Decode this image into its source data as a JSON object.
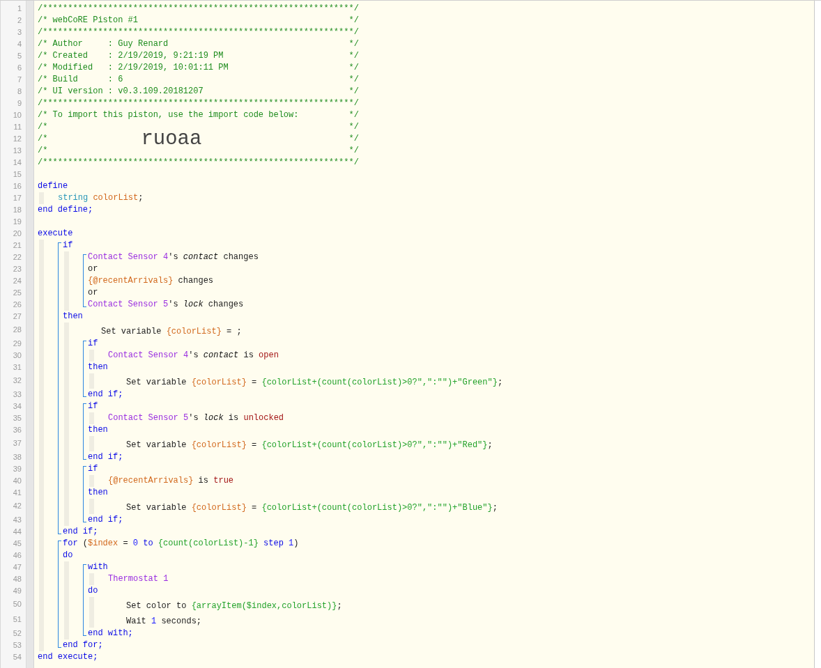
{
  "editor": {
    "lines": [
      {
        "number": "1",
        "kind": "line",
        "tokens": [
          {
            "kind": "comment",
            "text": "/**************************************************************/"
          }
        ]
      },
      {
        "number": "2",
        "kind": "line",
        "tokens": [
          {
            "kind": "comment",
            "text": "/* webCoRE Piston #1"
          },
          {
            "kind": "comment-end",
            "text": "*/"
          }
        ]
      },
      {
        "number": "3",
        "kind": "line",
        "tokens": [
          {
            "kind": "comment",
            "text": "/**************************************************************/"
          }
        ]
      },
      {
        "number": "4",
        "kind": "line",
        "tokens": [
          {
            "kind": "comment",
            "text": "/* Author     : Guy Renard"
          },
          {
            "kind": "comment-end",
            "text": "*/"
          }
        ]
      },
      {
        "number": "5",
        "kind": "line",
        "tokens": [
          {
            "kind": "comment",
            "text": "/* Created    : 2/19/2019, 9:21:19 PM"
          },
          {
            "kind": "comment-end",
            "text": "*/"
          }
        ]
      },
      {
        "number": "6",
        "kind": "line",
        "tokens": [
          {
            "kind": "comment",
            "text": "/* Modified   : 2/19/2019, 10:01:11 PM"
          },
          {
            "kind": "comment-end",
            "text": "*/"
          }
        ]
      },
      {
        "number": "7",
        "kind": "line",
        "tokens": [
          {
            "kind": "comment",
            "text": "/* Build      : 6"
          },
          {
            "kind": "comment-end",
            "text": "*/"
          }
        ]
      },
      {
        "number": "8",
        "kind": "line",
        "tokens": [
          {
            "kind": "comment",
            "text": "/* UI version : v0.3.109.20181207"
          },
          {
            "kind": "comment-end",
            "text": "*/"
          }
        ]
      },
      {
        "number": "9",
        "kind": "line",
        "tokens": [
          {
            "kind": "comment",
            "text": "/**************************************************************/"
          }
        ]
      },
      {
        "number": "10",
        "kind": "line",
        "tokens": [
          {
            "kind": "comment",
            "text": "/* To import this piston, use the import code below:"
          },
          {
            "kind": "comment-end",
            "text": "*/"
          }
        ]
      },
      {
        "number": "11",
        "kind": "line",
        "tokens": [
          {
            "kind": "comment",
            "text": "/*"
          },
          {
            "kind": "comment-end",
            "text": "*/"
          }
        ]
      },
      {
        "number": "12",
        "kind": "line",
        "tokens": [
          {
            "kind": "comment",
            "text": "/*"
          },
          {
            "kind": "import-code",
            "text": "ruoaa"
          },
          {
            "kind": "comment-end",
            "text": "*/"
          }
        ]
      },
      {
        "number": "13",
        "kind": "line",
        "tokens": [
          {
            "kind": "comment",
            "text": "/*"
          },
          {
            "kind": "comment-end",
            "text": "*/"
          }
        ]
      },
      {
        "number": "14",
        "kind": "line",
        "tokens": [
          {
            "kind": "comment",
            "text": "/**************************************************************/"
          }
        ]
      },
      {
        "number": "15",
        "kind": "line"
      },
      {
        "number": "16",
        "kind": "line",
        "tokens": [
          {
            "kind": "keyword",
            "text": "define"
          }
        ],
        "children": [
          {
            "number": "17",
            "kind": "line",
            "tokens": [
              {
                "kind": "type",
                "text": "string"
              },
              {
                "kind": "variable",
                "text": " colorList"
              },
              {
                "kind": "text",
                "text": ";"
              }
            ]
          }
        ]
      },
      {
        "number": "18",
        "kind": "line",
        "tokens": [
          {
            "kind": "keyword",
            "text": "end define;"
          }
        ]
      },
      {
        "number": "19",
        "kind": "line"
      },
      {
        "number": "20",
        "kind": "line",
        "tokens": [
          {
            "kind": "keyword",
            "text": "execute"
          }
        ],
        "children": [
          {
            "kind": "block",
            "children": [
              {
                "number": "21",
                "kind": "line",
                "tokens": [
                  {
                    "kind": "keyword",
                    "text": "if"
                  }
                ],
                "children": [
                  {
                    "kind": "block",
                    "children": [
                      {
                        "number": "22",
                        "kind": "line",
                        "tokens": [
                          {
                            "kind": "device",
                            "text": "Contact Sensor 4"
                          },
                          {
                            "kind": "text",
                            "text": "'s "
                          },
                          {
                            "kind": "attribute",
                            "text": "contact"
                          },
                          {
                            "kind": "text",
                            "text": " changes"
                          }
                        ]
                      },
                      {
                        "number": "23",
                        "kind": "line",
                        "tokens": [
                          {
                            "kind": "text",
                            "text": "or"
                          }
                        ]
                      },
                      {
                        "number": "24",
                        "kind": "line",
                        "tokens": [
                          {
                            "kind": "variable",
                            "text": "{@recentArrivals}"
                          },
                          {
                            "kind": "text",
                            "text": " changes"
                          }
                        ]
                      },
                      {
                        "number": "25",
                        "kind": "line",
                        "tokens": [
                          {
                            "kind": "text",
                            "text": "or"
                          }
                        ]
                      },
                      {
                        "number": "26",
                        "kind": "line",
                        "tokens": [
                          {
                            "kind": "device",
                            "text": "Contact Sensor 5"
                          },
                          {
                            "kind": "text",
                            "text": "'s "
                          },
                          {
                            "kind": "attribute",
                            "text": "lock"
                          },
                          {
                            "kind": "text",
                            "text": " changes"
                          }
                        ]
                      }
                    ]
                  }
                ]
              },
              {
                "number": "27",
                "kind": "line",
                "tokens": [
                  {
                    "kind": "keyword",
                    "text": "then"
                  }
                ],
                "children": [
                  {
                    "number": "28",
                    "kind": "statement",
                    "tokens": [
                      {
                        "kind": "text",
                        "text": "Set variable "
                      },
                      {
                        "kind": "variable",
                        "text": "{colorList}"
                      },
                      {
                        "kind": "text",
                        "text": " = ;"
                      }
                    ]
                  },
                  {
                    "kind": "block",
                    "children": [
                      {
                        "number": "29",
                        "kind": "line",
                        "tokens": [
                          {
                            "kind": "keyword",
                            "text": "if"
                          }
                        ],
                        "children": [
                          {
                            "number": "30",
                            "kind": "line",
                            "tokens": [
                              {
                                "kind": "device",
                                "text": "Contact Sensor 4"
                              },
                              {
                                "kind": "text",
                                "text": "'s "
                              },
                              {
                                "kind": "attribute",
                                "text": "contact"
                              },
                              {
                                "kind": "text",
                                "text": " is "
                              },
                              {
                                "kind": "value",
                                "text": "open"
                              }
                            ]
                          }
                        ]
                      },
                      {
                        "number": "31",
                        "kind": "line",
                        "tokens": [
                          {
                            "kind": "keyword",
                            "text": "then"
                          }
                        ],
                        "children": [
                          {
                            "number": "32",
                            "kind": "statement",
                            "tokens": [
                              {
                                "kind": "text",
                                "text": "Set variable "
                              },
                              {
                                "kind": "variable",
                                "text": "{colorList}"
                              },
                              {
                                "kind": "text",
                                "text": " = "
                              },
                              {
                                "kind": "expression",
                                "text": "{colorList+(count(colorList)>0?\",\":\"\")+\"Green\"}"
                              },
                              {
                                "kind": "text",
                                "text": ";"
                              }
                            ]
                          }
                        ]
                      },
                      {
                        "number": "33",
                        "kind": "line",
                        "tokens": [
                          {
                            "kind": "keyword",
                            "text": "end if;"
                          }
                        ]
                      }
                    ]
                  },
                  {
                    "kind": "block",
                    "children": [
                      {
                        "number": "34",
                        "kind": "line",
                        "tokens": [
                          {
                            "kind": "keyword",
                            "text": "if"
                          }
                        ],
                        "children": [
                          {
                            "number": "35",
                            "kind": "line",
                            "tokens": [
                              {
                                "kind": "device",
                                "text": "Contact Sensor 5"
                              },
                              {
                                "kind": "text",
                                "text": "'s "
                              },
                              {
                                "kind": "attribute",
                                "text": "lock"
                              },
                              {
                                "kind": "text",
                                "text": " is "
                              },
                              {
                                "kind": "value",
                                "text": "unlocked"
                              }
                            ]
                          }
                        ]
                      },
                      {
                        "number": "36",
                        "kind": "line",
                        "tokens": [
                          {
                            "kind": "keyword",
                            "text": "then"
                          }
                        ],
                        "children": [
                          {
                            "number": "37",
                            "kind": "statement",
                            "tokens": [
                              {
                                "kind": "text",
                                "text": "Set variable "
                              },
                              {
                                "kind": "variable",
                                "text": "{colorList}"
                              },
                              {
                                "kind": "text",
                                "text": " = "
                              },
                              {
                                "kind": "expression",
                                "text": "{colorList+(count(colorList)>0?\",\":\"\")+\"Red\"}"
                              },
                              {
                                "kind": "text",
                                "text": ";"
                              }
                            ]
                          }
                        ]
                      },
                      {
                        "number": "38",
                        "kind": "line",
                        "tokens": [
                          {
                            "kind": "keyword",
                            "text": "end if;"
                          }
                        ]
                      }
                    ]
                  },
                  {
                    "kind": "block",
                    "children": [
                      {
                        "number": "39",
                        "kind": "line",
                        "tokens": [
                          {
                            "kind": "keyword",
                            "text": "if"
                          }
                        ],
                        "children": [
                          {
                            "number": "40",
                            "kind": "line",
                            "tokens": [
                              {
                                "kind": "variable",
                                "text": "{@recentArrivals}"
                              },
                              {
                                "kind": "text",
                                "text": " is "
                              },
                              {
                                "kind": "value",
                                "text": "true"
                              }
                            ]
                          }
                        ]
                      },
                      {
                        "number": "41",
                        "kind": "line",
                        "tokens": [
                          {
                            "kind": "keyword",
                            "text": "then"
                          }
                        ],
                        "children": [
                          {
                            "number": "42",
                            "kind": "statement",
                            "tokens": [
                              {
                                "kind": "text",
                                "text": "Set variable "
                              },
                              {
                                "kind": "variable",
                                "text": "{colorList}"
                              },
                              {
                                "kind": "text",
                                "text": " = "
                              },
                              {
                                "kind": "expression",
                                "text": "{colorList+(count(colorList)>0?\",\":\"\")+\"Blue\"}"
                              },
                              {
                                "kind": "text",
                                "text": ";"
                              }
                            ]
                          }
                        ]
                      },
                      {
                        "number": "43",
                        "kind": "line",
                        "tokens": [
                          {
                            "kind": "keyword",
                            "text": "end if;"
                          }
                        ]
                      }
                    ]
                  }
                ]
              },
              {
                "number": "44",
                "kind": "line",
                "tokens": [
                  {
                    "kind": "keyword",
                    "text": "end if;"
                  }
                ]
              }
            ]
          },
          {
            "kind": "block",
            "children": [
              {
                "number": "45",
                "kind": "line",
                "tokens": [
                  {
                    "kind": "keyword",
                    "text": "for"
                  },
                  {
                    "kind": "text",
                    "text": " ("
                  },
                  {
                    "kind": "variable",
                    "text": "$index"
                  },
                  {
                    "kind": "text",
                    "text": " = "
                  },
                  {
                    "kind": "number",
                    "text": "0"
                  },
                  {
                    "kind": "keyword",
                    "text": " to"
                  },
                  {
                    "kind": "expression",
                    "text": " {count(colorList)-1}"
                  },
                  {
                    "kind": "keyword",
                    "text": " step"
                  },
                  {
                    "kind": "number",
                    "text": " 1"
                  },
                  {
                    "kind": "text",
                    "text": ")"
                  }
                ]
              },
              {
                "number": "46",
                "kind": "line",
                "tokens": [
                  {
                    "kind": "keyword",
                    "text": "do"
                  }
                ],
                "children": [
                  {
                    "kind": "block",
                    "children": [
                      {
                        "number": "47",
                        "kind": "line",
                        "tokens": [
                          {
                            "kind": "keyword",
                            "text": "with"
                          }
                        ],
                        "children": [
                          {
                            "number": "48",
                            "kind": "line",
                            "tokens": [
                              {
                                "kind": "device",
                                "text": "Thermostat 1"
                              }
                            ]
                          }
                        ]
                      },
                      {
                        "number": "49",
                        "kind": "line",
                        "tokens": [
                          {
                            "kind": "keyword",
                            "text": "do"
                          }
                        ],
                        "children": [
                          {
                            "number": "50",
                            "kind": "statement",
                            "tokens": [
                              {
                                "kind": "text",
                                "text": "Set color to "
                              },
                              {
                                "kind": "expression",
                                "text": "{arrayItem($index,colorList)}"
                              },
                              {
                                "kind": "text",
                                "text": ";"
                              }
                            ]
                          },
                          {
                            "number": "51",
                            "kind": "statement",
                            "tokens": [
                              {
                                "kind": "text",
                                "text": "Wait "
                              },
                              {
                                "kind": "number",
                                "text": "1"
                              },
                              {
                                "kind": "text",
                                "text": " seconds;"
                              }
                            ]
                          }
                        ]
                      },
                      {
                        "number": "52",
                        "kind": "line",
                        "tokens": [
                          {
                            "kind": "keyword",
                            "text": "end with;"
                          }
                        ]
                      }
                    ]
                  }
                ]
              },
              {
                "number": "53",
                "kind": "line",
                "tokens": [
                  {
                    "kind": "keyword",
                    "text": "end for;"
                  }
                ]
              }
            ]
          }
        ]
      },
      {
        "number": "54",
        "kind": "line",
        "tokens": [
          {
            "kind": "keyword",
            "text": "end execute;"
          }
        ]
      }
    ]
  }
}
